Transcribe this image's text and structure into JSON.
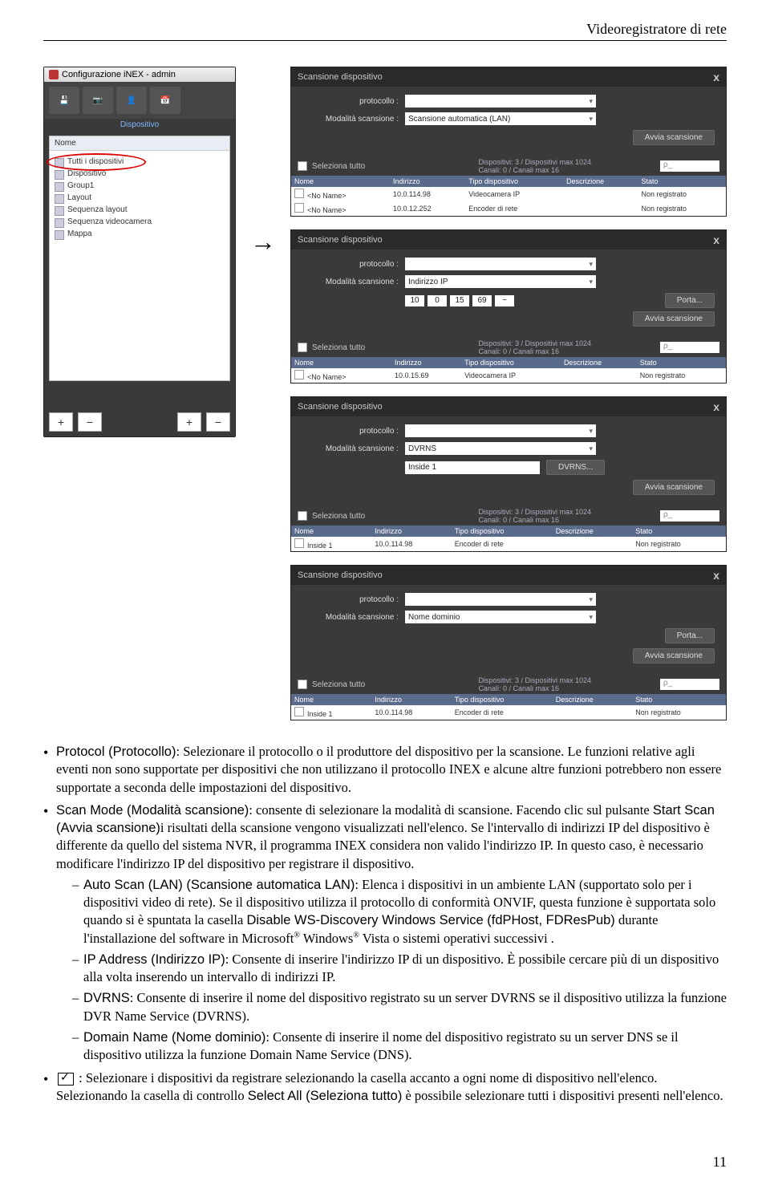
{
  "running_head": "Videoregistratore di rete",
  "page_number": "11",
  "arrow_glyph": "→",
  "app_panel": {
    "title": "Configurazione iNEX - admin",
    "tab_label": "Dispositivo",
    "tree_header": "Nome",
    "tree": [
      {
        "label": "Tutti i dispositivi",
        "circled": true
      },
      {
        "label": "Dispositivo"
      },
      {
        "label": "Group1"
      },
      {
        "label": "Layout"
      },
      {
        "label": "Sequenza layout"
      },
      {
        "label": "Sequenza videocamera"
      },
      {
        "label": "Mappa"
      }
    ],
    "buttons": {
      "plus": "+",
      "minus": "−"
    }
  },
  "dialogs": [
    {
      "title": "Scansione dispositivo",
      "close": "x",
      "rows": [
        {
          "label": "protocollo :",
          "value": ""
        },
        {
          "label": "Modalità scansione :",
          "value": "Scansione automatica (LAN)"
        }
      ],
      "scan_btn": "Avvia scansione",
      "select_all": "Seleziona tutto",
      "stats": "Dispositivi: 3 / Dispositivi max 1024\nCanali: 0 / Canali max 16",
      "search": "ρ_",
      "headers": [
        "Nome",
        "Indirizzo",
        "Tipo dispositivo",
        "Descrizione",
        "Stato"
      ],
      "rows_data": [
        [
          "<No Name>",
          "10.0.114.98",
          "Videocamera IP",
          "",
          "Non registrato"
        ],
        [
          "<No Name>",
          "10.0.12.252",
          "Encoder di rete",
          "",
          "Non registrato"
        ]
      ]
    },
    {
      "title": "Scansione dispositivo",
      "close": "x",
      "rows": [
        {
          "label": "protocollo :",
          "value": ""
        },
        {
          "label": "Modalità scansione :",
          "value": "Indirizzo IP"
        }
      ],
      "ip": [
        "10",
        "0",
        "15",
        "69",
        "~"
      ],
      "extra_btn": "Porta...",
      "scan_btn": "Avvia scansione",
      "select_all": "Seleziona tutto",
      "stats": "Dispositivi: 3 / Dispositivi max 1024\nCanali: 0 / Canali max 16",
      "search": "ρ_",
      "headers": [
        "Nome",
        "Indirizzo",
        "Tipo dispositivo",
        "Descrizione",
        "Stato"
      ],
      "rows_data": [
        [
          "<No Name>",
          "10.0.15.69",
          "Videocamera IP",
          "",
          "Non registrato"
        ]
      ]
    },
    {
      "title": "Scansione dispositivo",
      "close": "x",
      "rows": [
        {
          "label": "protocollo :",
          "value": ""
        },
        {
          "label": "Modalità scansione :",
          "value": "DVRNS"
        }
      ],
      "dvrns_name": "Inside 1",
      "dvrns_btn": "DVRNS...",
      "scan_btn": "Avvia scansione",
      "select_all": "Seleziona tutto",
      "stats": "Dispositivi: 3 / Dispositivi max 1024\nCanali: 0 / Canali max 16",
      "search": "ρ_",
      "headers": [
        "Nome",
        "Indirizzo",
        "Tipo dispositivo",
        "Descrizione",
        "Stato"
      ],
      "rows_data": [
        [
          "Inside 1",
          "10.0.114.98",
          "Encoder di rete",
          "",
          "Non registrato"
        ]
      ]
    },
    {
      "title": "Scansione dispositivo",
      "close": "x",
      "rows": [
        {
          "label": "protocollo :",
          "value": ""
        },
        {
          "label": "Modalità scansione :",
          "value": "Nome dominio"
        }
      ],
      "extra_btn": "Porta...",
      "scan_btn": "Avvia scansione",
      "select_all": "Seleziona tutto",
      "stats": "Dispositivi: 3 / Dispositivi max 1024\nCanali: 0 / Canali max 16",
      "search": "ρ_",
      "headers": [
        "Nome",
        "Indirizzo",
        "Tipo dispositivo",
        "Descrizione",
        "Stato"
      ],
      "rows_data": [
        [
          "Inside 1",
          "10.0.114.98",
          "Encoder di rete",
          "",
          "Non registrato"
        ]
      ]
    }
  ],
  "text": {
    "b1_label": "Protocol (Protocollo)",
    "b1_body": ": Selezionare il protocollo o il produttore del dispositivo per la scansione.  Le funzioni relative agli eventi non sono supportate per dispositivi che non utilizzano il protocollo INEX e alcune altre funzioni potrebbero non essere supportate a seconda delle impostazioni del dispositivo.",
    "b2_label": "Scan Mode (Modalità scansione)",
    "b2_body_a": ": consente di selezionare la modalità di scansione.  Facendo clic sul pulsante ",
    "b2_inline": "Start Scan (Avvia scansione)",
    "b2_body_b": "i risultati della scansione vengono visualizzati nell'elenco. Se l'intervallo di indirizzi IP del dispositivo è differente da quello del sistema NVR, il programma INEX considera non valido l'indirizzo IP.  In questo caso, è necessario modificare l'indirizzo IP del dispositivo per registrare il dispositivo.",
    "s1_label": "Auto Scan (LAN) (Scansione automatica LAN)",
    "s1_body_a": ": Elenca i dispositivi in un ambiente LAN (supportato solo per i dispositivi video di rete).  Se il dispositivo utilizza il protocollo di conformità ONVIF, questa funzione è supportata solo quando si è spuntata la casella ",
    "s1_inline": "Disable WS-Discovery Windows Service (fdPHost, FDResPub)",
    "s1_body_b": " durante l'installazione del software  in Microsoft",
    "s1_body_c": " Windows",
    "s1_body_d": " Vista o sistemi operativi successivi .",
    "s2_label": "IP Address (Indirizzo IP)",
    "s2_body": ": Consente di inserire l'indirizzo IP di un dispositivo.  È possibile cercare più di un dispositivo alla volta inserendo un intervallo di indirizzi IP.",
    "s3_label": "DVRNS",
    "s3_body": ": Consente di inserire il nome del dispositivo registrato su un server DVRNS se il dispositivo utilizza la funzione DVR Name Service (DVRNS).",
    "s4_label": "Domain Name (Nome dominio)",
    "s4_body": ": Consente di inserire il nome del dispositivo registrato su un server DNS se il dispositivo utilizza la funzione Domain Name Service (DNS).",
    "b3_body_a": " : Selezionare i dispositivi da registrare selezionando la casella accanto a ogni nome di dispositivo nell'elenco.  Selezionando la casella di controllo ",
    "b3_inline": "Select All (Seleziona tutto)",
    "b3_body_b": " è possibile selezionare tutti i dispositivi presenti nell'elenco.",
    "reg": "®"
  }
}
